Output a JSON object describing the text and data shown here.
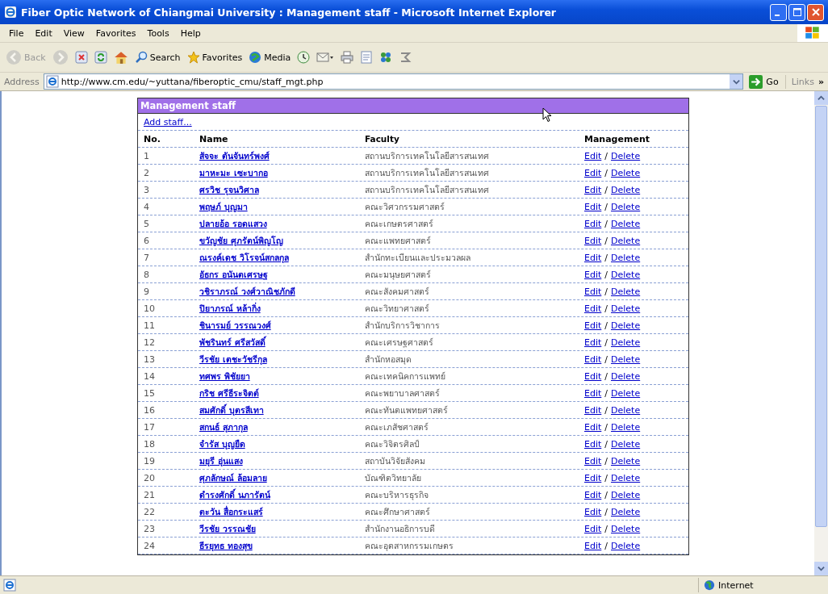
{
  "window": {
    "title": "Fiber Optic Network of Chiangmai University : Management staff - Microsoft Internet Explorer"
  },
  "menu": [
    "File",
    "Edit",
    "View",
    "Favorites",
    "Tools",
    "Help"
  ],
  "toolbar": [
    {
      "kind": "back",
      "label": "Back",
      "disabled": true
    },
    {
      "kind": "forward",
      "disabled": true
    },
    {
      "kind": "stop",
      "disabled": false
    },
    {
      "kind": "refresh",
      "disabled": false
    },
    {
      "kind": "home",
      "disabled": false
    },
    {
      "kind": "search",
      "label": "Search",
      "disabled": false
    },
    {
      "kind": "favorites",
      "label": "Favorites",
      "disabled": false
    },
    {
      "kind": "media",
      "label": "Media",
      "disabled": false
    },
    {
      "kind": "history",
      "disabled": false
    },
    {
      "kind": "mail",
      "disabled": false
    },
    {
      "kind": "print",
      "disabled": false
    },
    {
      "kind": "edit",
      "disabled": false
    },
    {
      "kind": "messenger",
      "disabled": false
    },
    {
      "kind": "research",
      "disabled": false
    }
  ],
  "address_bar": {
    "label": "Address",
    "url": "http://www.cm.edu/~yuttana/fiberoptic_cmu/staff_mgt.php",
    "go": "Go",
    "links": "Links",
    "more": "»"
  },
  "panel": {
    "title": "Management staff",
    "add_link": "Add staff...",
    "columns": [
      "No.",
      "Name",
      "Faculty",
      "Management"
    ],
    "rows": [
      {
        "no": "1",
        "name": "สัจจะ ตันจันทร์พงศ์",
        "faculty": "สถานบริการเทคโนโลยีสารสนเทศ",
        "edit": "Edit",
        "sep": "/",
        "delete": "Delete"
      },
      {
        "no": "2",
        "name": "มาหะมะ เซะบากอ",
        "faculty": "สถานบริการเทคโนโลยีสารสนเทศ",
        "edit": "Edit",
        "sep": "/",
        "delete": "Delete"
      },
      {
        "no": "3",
        "name": "ศรวิช รุจนวิศาล",
        "faculty": "สถานบริการเทคโนโลยีสารสนเทศ",
        "edit": "Edit",
        "sep": "/",
        "delete": "Delete"
      },
      {
        "no": "4",
        "name": "พฤษภ์ บุญมา",
        "faculty": "คณะวิศวกรรมศาสตร์",
        "edit": "Edit",
        "sep": "/",
        "delete": "Delete"
      },
      {
        "no": "5",
        "name": "ปลายอ้อ รอดแสวง",
        "faculty": "คณะเกษตรศาสตร์",
        "edit": "Edit",
        "sep": "/",
        "delete": "Delete"
      },
      {
        "no": "6",
        "name": "ขวัญชัย ศุภรัตน์พิญโญ",
        "faculty": "คณะแพทยศาสตร์",
        "edit": "Edit",
        "sep": "/",
        "delete": "Delete"
      },
      {
        "no": "7",
        "name": "ณรงค์เดช วิโรจน์สกลกุล",
        "faculty": "สำนักทะเบียนและประมวลผล",
        "edit": "Edit",
        "sep": "/",
        "delete": "Delete"
      },
      {
        "no": "8",
        "name": "อัธกร อนันตเศรษฐ",
        "faculty": "คณะมนุษยศาสตร์",
        "edit": "Edit",
        "sep": "/",
        "delete": "Delete"
      },
      {
        "no": "9",
        "name": "วชิราภรณ์ วงศ์วาณิชภักดี",
        "faculty": "คณะสังคมศาสตร์",
        "edit": "Edit",
        "sep": "/",
        "delete": "Delete"
      },
      {
        "no": "10",
        "name": "ปิยาภรณ์ หล้ากิ่ง",
        "faculty": "คณะวิทยาศาสตร์",
        "edit": "Edit",
        "sep": "/",
        "delete": "Delete"
      },
      {
        "no": "11",
        "name": "ชินารมย์ วรรณวงศ์",
        "faculty": "สำนักบริการวิชาการ",
        "edit": "Edit",
        "sep": "/",
        "delete": "Delete"
      },
      {
        "no": "12",
        "name": "พัชรินทร์ ศรีสวัสดิ์",
        "faculty": "คณะเศรษฐศาสตร์",
        "edit": "Edit",
        "sep": "/",
        "delete": "Delete"
      },
      {
        "no": "13",
        "name": "วีรชัย เตชะวัชรีกุล",
        "faculty": "สำนักหอสมุด",
        "edit": "Edit",
        "sep": "/",
        "delete": "Delete"
      },
      {
        "no": "14",
        "name": "ทศพร พิชัยยา",
        "faculty": "คณะเทคนิคการแพทย์",
        "edit": "Edit",
        "sep": "/",
        "delete": "Delete"
      },
      {
        "no": "15",
        "name": "กริช ศรีธีระจิตต์",
        "faculty": "คณะพยาบาลศาสตร์",
        "edit": "Edit",
        "sep": "/",
        "delete": "Delete"
      },
      {
        "no": "16",
        "name": "สมศักดิ์ บุตรสีเทา",
        "faculty": "คณะทันตแพทยศาสตร์",
        "edit": "Edit",
        "sep": "/",
        "delete": "Delete"
      },
      {
        "no": "17",
        "name": "สกนธ์ สุภากุล",
        "faculty": "คณะเภสัชศาสตร์",
        "edit": "Edit",
        "sep": "/",
        "delete": "Delete"
      },
      {
        "no": "18",
        "name": "จำรัส บุญยืด",
        "faculty": "คณะวิจิตรศิลป์",
        "edit": "Edit",
        "sep": "/",
        "delete": "Delete"
      },
      {
        "no": "19",
        "name": "มยุรี อุ่นแสง",
        "faculty": "สถาบันวิจัยสังคม",
        "edit": "Edit",
        "sep": "/",
        "delete": "Delete"
      },
      {
        "no": "20",
        "name": "ศุภลักษณ์ ล้อมลาย",
        "faculty": "บัณฑิตวิทยาลัย",
        "edit": "Edit",
        "sep": "/",
        "delete": "Delete"
      },
      {
        "no": "21",
        "name": "ดำรงศักดิ์ นภารัตน์",
        "faculty": "คณะบริหารธุรกิจ",
        "edit": "Edit",
        "sep": "/",
        "delete": "Delete"
      },
      {
        "no": "22",
        "name": "ตะวัน สื่อกระแสร์",
        "faculty": "คณะศึกษาศาสตร์",
        "edit": "Edit",
        "sep": "/",
        "delete": "Delete"
      },
      {
        "no": "23",
        "name": "วีรชัย วรรณชัย",
        "faculty": "สำนักงานอธิการบดี",
        "edit": "Edit",
        "sep": "/",
        "delete": "Delete"
      },
      {
        "no": "24",
        "name": "ธีรยุทธ ทองสุข",
        "faculty": "คณะอุตสาหกรรมเกษตร",
        "edit": "Edit",
        "sep": "/",
        "delete": "Delete"
      }
    ]
  },
  "status_bar": {
    "zone": "Internet"
  }
}
